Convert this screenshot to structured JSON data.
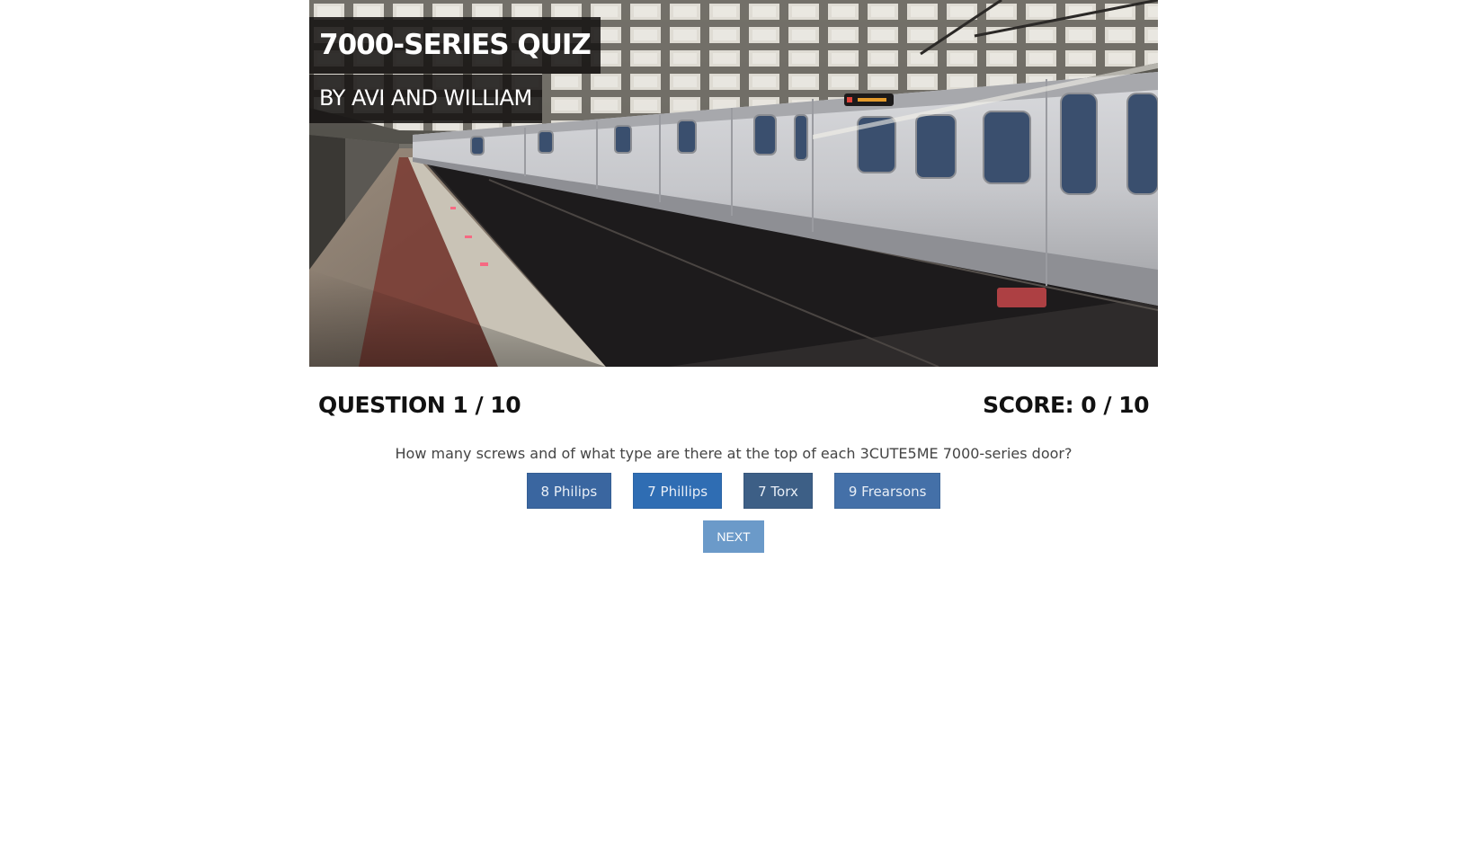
{
  "quiz": {
    "title": "7000-SERIES QUIZ",
    "byline": "BY AVI AND WILLIAM"
  },
  "status": {
    "question_counter": "QUESTION 1 / 10",
    "score_counter": "SCORE: 0 / 10"
  },
  "question": {
    "text": "How many screws and of what type are there at the top of each 3CUTE5ME 7000-series door?"
  },
  "answers": [
    {
      "label": "8 Philips",
      "color": "#3a66a0"
    },
    {
      "label": "7 Phillips",
      "color": "#2f6db3"
    },
    {
      "label": "7 Torx",
      "color": "#3d5f86"
    },
    {
      "label": "9 Frearsons",
      "color": "#4470a8"
    }
  ],
  "next": {
    "label": "NEXT",
    "color": "#6b9ac9"
  }
}
